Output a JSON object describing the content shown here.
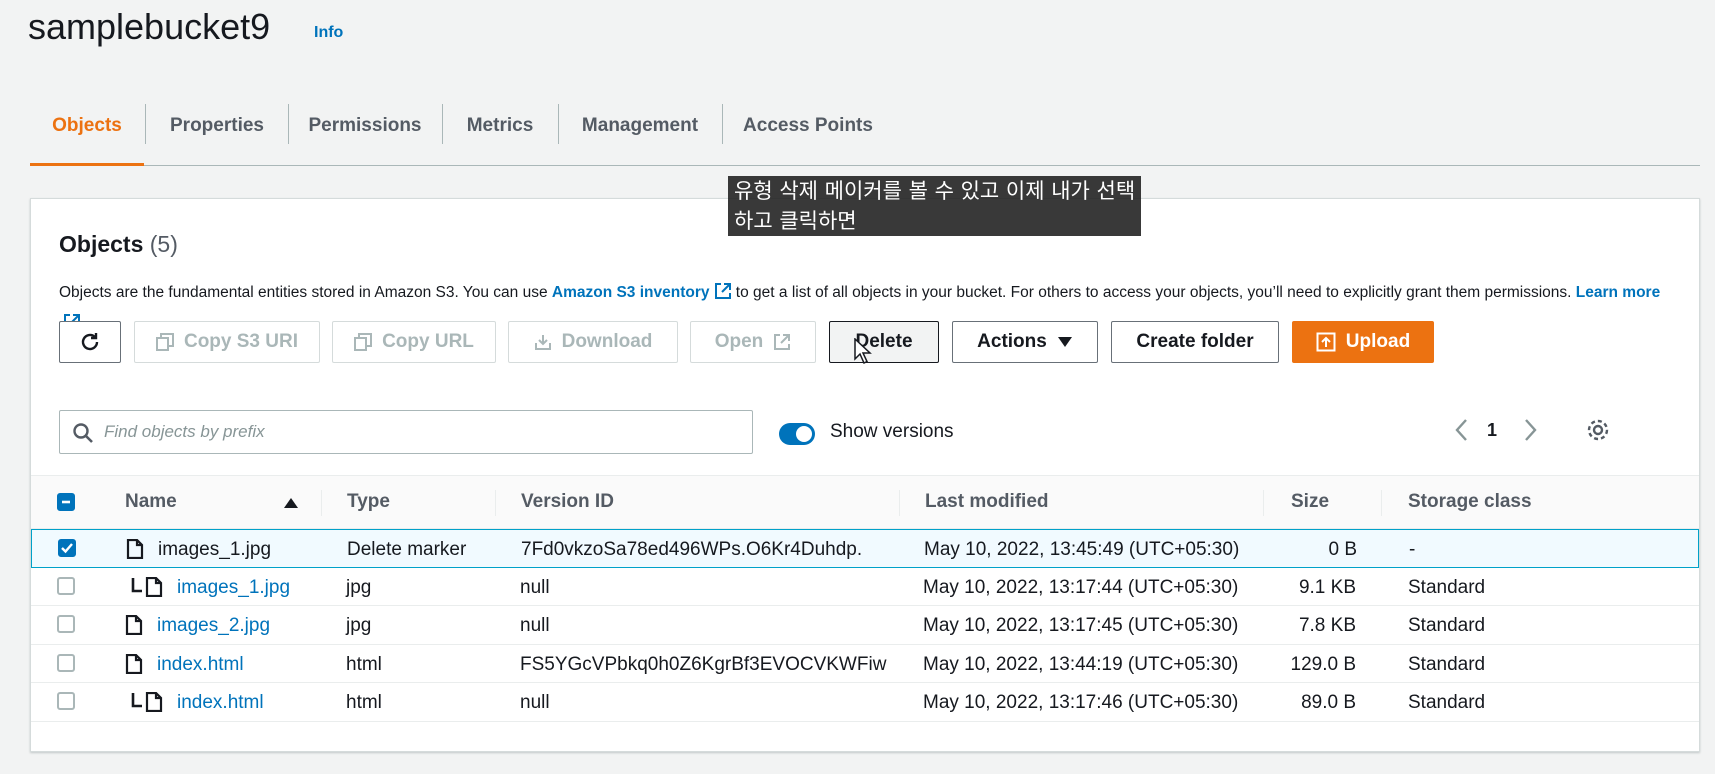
{
  "bucket": {
    "title": "samplebucket9",
    "info_link": "Info"
  },
  "tabs": [
    "Objects",
    "Properties",
    "Permissions",
    "Metrics",
    "Management",
    "Access Points"
  ],
  "active_tab": "Objects",
  "caption": {
    "line1": "유형 삭제 메이커를 볼 수 있고 이제 내가 선택",
    "line2": "하고 클릭하면"
  },
  "objects": {
    "title": "Objects",
    "count": "(5)",
    "desc_1": "Objects are the fundamental entities stored in Amazon S3. You can use ",
    "inventory_link": "Amazon S3 inventory",
    "desc_2": " to get a list of all objects in your bucket. For others to access your objects, you’ll need to explicitly grant them permissions. ",
    "learn_more": "Learn more"
  },
  "toolbar": {
    "copy_s3_uri": "Copy S3 URI",
    "copy_url": "Copy URL",
    "download": "Download",
    "open": "Open",
    "delete": "Delete",
    "actions": "Actions",
    "create_folder": "Create folder",
    "upload": "Upload"
  },
  "search": {
    "placeholder": "Find objects by prefix",
    "value": ""
  },
  "show_versions": {
    "label": "Show versions",
    "on": true
  },
  "pagination": {
    "page": "1"
  },
  "columns": [
    "Name",
    "Type",
    "Version ID",
    "Last modified",
    "Size",
    "Storage class"
  ],
  "rows": [
    {
      "name": "images_1.jpg",
      "type": "Delete marker",
      "version_id": "7Fd0vkzoSa78ed496WPs.O6Kr4Duhdp.",
      "last_modified": "May 10, 2022, 13:45:49 (UTC+05:30)",
      "size": "0 B",
      "storage_class": "-",
      "checked": true,
      "child": false
    },
    {
      "name": "images_1.jpg",
      "type": "jpg",
      "version_id": "null",
      "last_modified": "May 10, 2022, 13:17:44 (UTC+05:30)",
      "size": "9.1 KB",
      "storage_class": "Standard",
      "checked": false,
      "child": true
    },
    {
      "name": "images_2.jpg",
      "type": "jpg",
      "version_id": "null",
      "last_modified": "May 10, 2022, 13:17:45 (UTC+05:30)",
      "size": "7.8 KB",
      "storage_class": "Standard",
      "checked": false,
      "child": false
    },
    {
      "name": "index.html",
      "type": "html",
      "version_id": "FS5YGcVPbkq0h0Z6KgrBf3EVOCVKWFiw",
      "last_modified": "May 10, 2022, 13:44:19 (UTC+05:30)",
      "size": "129.0 B",
      "storage_class": "Standard",
      "checked": false,
      "child": false
    },
    {
      "name": "index.html",
      "type": "html",
      "version_id": "null",
      "last_modified": "May 10, 2022, 13:17:46 (UTC+05:30)",
      "size": "89.0 B",
      "storage_class": "Standard",
      "checked": false,
      "child": true
    }
  ],
  "colors": {
    "accent": "#ec7211",
    "link": "#0073bb",
    "selected_border": "#00a1c9"
  }
}
